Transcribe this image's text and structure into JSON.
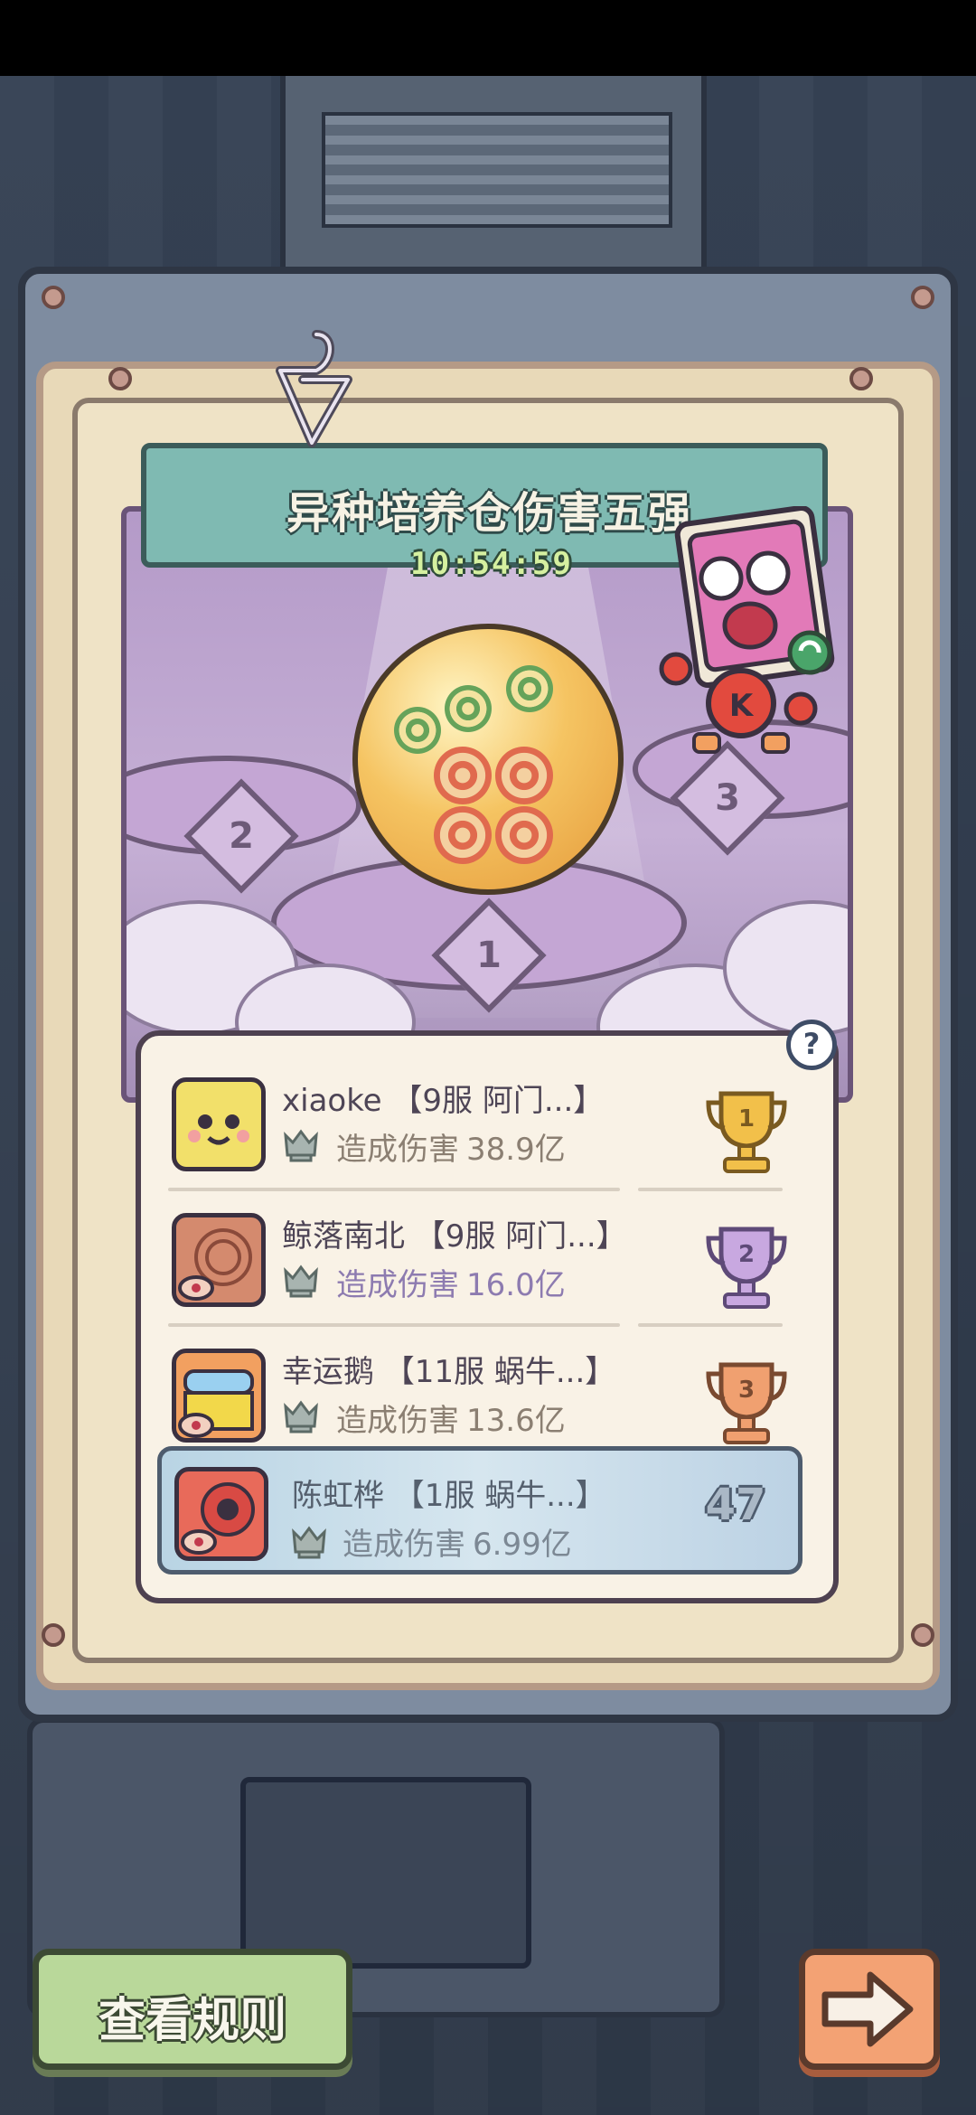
{
  "event": {
    "title": "异种培养仓伤害五强",
    "countdown": "10:54:59"
  },
  "arena": {
    "pedestals": [
      "1",
      "2",
      "3"
    ]
  },
  "leaderboard": {
    "help_label": "?",
    "damage_label": "造成伤害",
    "entries": [
      {
        "rank": 1,
        "name": "xiaoke 【9服 阿门...】",
        "damage": "38.9亿",
        "trophy": "gold-trophy-icon"
      },
      {
        "rank": 2,
        "name": "鲸落南北 【9服 阿门...】",
        "damage": "16.0亿",
        "trophy": "silver-trophy-icon"
      },
      {
        "rank": 3,
        "name": "幸运鹅 【11服 蜗牛...】",
        "damage": "13.6亿",
        "trophy": "bronze-trophy-icon"
      }
    ],
    "self": {
      "rank": "47",
      "name": "陈虹桦 【1服 蜗牛...】",
      "damage": "6.99亿"
    }
  },
  "buttons": {
    "rules": "查看规则",
    "next_icon": "right-arrow-icon"
  },
  "colors": {
    "banner": "#7fbab2",
    "arena": "#b49ac8",
    "rules_button": "#b9d89a",
    "next_button": "#f3a274",
    "gold": "#f2c04a",
    "silver": "#c8a8e0",
    "bronze": "#f0a070"
  }
}
